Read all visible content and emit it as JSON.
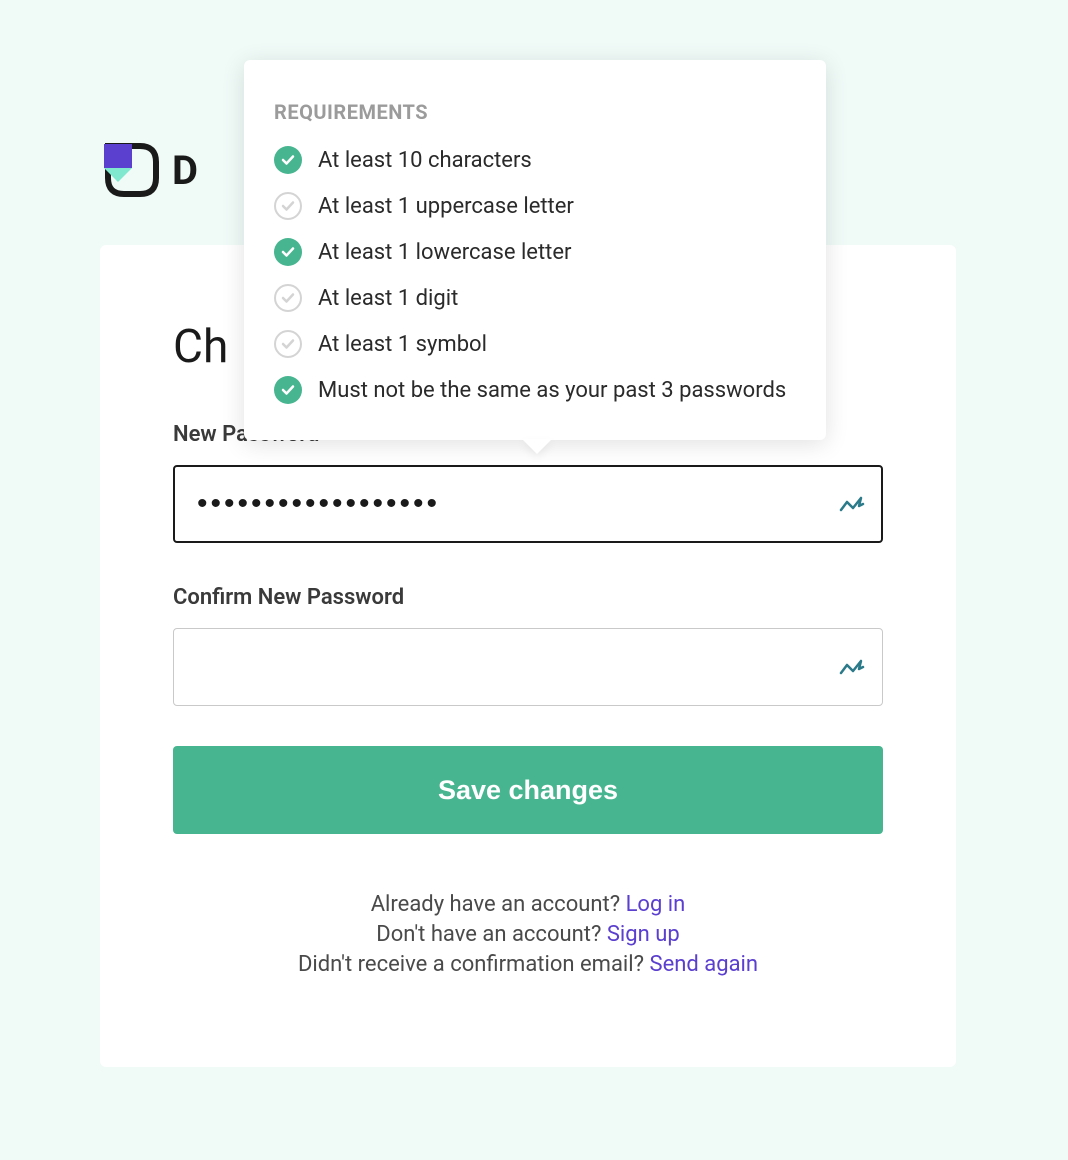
{
  "logo": {
    "text_partial": "D"
  },
  "card": {
    "title_partial": "Ch",
    "new_password_label": "New Password",
    "new_password_value": "••••••••••••••••••",
    "confirm_password_label": "Confirm New Password",
    "confirm_password_value": "",
    "save_button_label": "Save changes"
  },
  "tooltip": {
    "title": "REQUIREMENTS",
    "requirements": [
      {
        "text": "At least 10 characters",
        "met": true
      },
      {
        "text": "At least 1 uppercase letter",
        "met": false
      },
      {
        "text": "At least 1 lowercase letter",
        "met": true
      },
      {
        "text": "At least 1 digit",
        "met": false
      },
      {
        "text": "At least 1 symbol",
        "met": false
      },
      {
        "text": "Must not be the same as your past 3 passwords",
        "met": true
      }
    ]
  },
  "footer": {
    "login_text": "Already have an account? ",
    "login_link": "Log in",
    "signup_text": "Don't have an account? ",
    "signup_link": "Sign up",
    "resend_text": "Didn't receive a confirmation email? ",
    "resend_link": "Send again"
  },
  "colors": {
    "accent": "#48b591",
    "link": "#5b3fcf",
    "bg": "#f0faf7"
  }
}
